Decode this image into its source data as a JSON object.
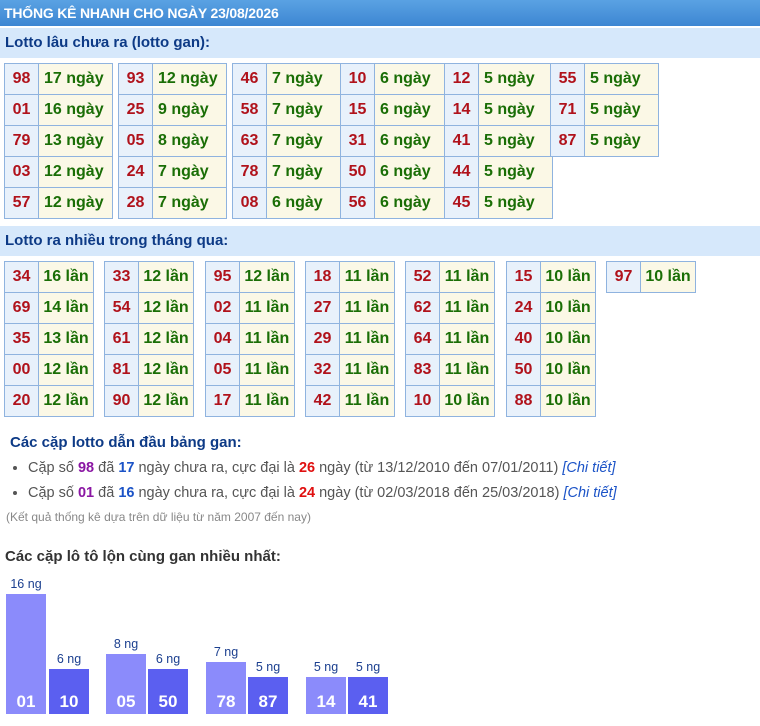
{
  "title": "THỐNG KÊ NHANH CHO NGÀY 23/08/2026",
  "gan": {
    "heading": "Lotto lâu chưa ra (lotto gan):",
    "groups": [
      [
        [
          "98",
          "17 ngày"
        ],
        [
          "01",
          "16 ngày"
        ],
        [
          "79",
          "13 ngày"
        ],
        [
          "03",
          "12 ngày"
        ],
        [
          "57",
          "12 ngày"
        ]
      ],
      [
        [
          "93",
          "12 ngày"
        ],
        [
          "25",
          "9 ngày"
        ],
        [
          "05",
          "8 ngày"
        ],
        [
          "24",
          "7 ngày"
        ],
        [
          "28",
          "7 ngày"
        ]
      ],
      [
        [
          "46",
          "7 ngày"
        ],
        [
          "58",
          "7 ngày"
        ],
        [
          "63",
          "7 ngày"
        ],
        [
          "78",
          "7 ngày"
        ],
        [
          "08",
          "6 ngày"
        ]
      ],
      [
        [
          "10",
          "6 ngày"
        ],
        [
          "15",
          "6 ngày"
        ],
        [
          "31",
          "6 ngày"
        ],
        [
          "50",
          "6 ngày"
        ],
        [
          "56",
          "6 ngày"
        ]
      ],
      [
        [
          "12",
          "5 ngày"
        ],
        [
          "14",
          "5 ngày"
        ],
        [
          "41",
          "5 ngày"
        ],
        [
          "44",
          "5 ngày"
        ],
        [
          "45",
          "5 ngày"
        ]
      ],
      [
        [
          "55",
          "5 ngày"
        ],
        [
          "71",
          "5 ngày"
        ],
        [
          "87",
          "5 ngày"
        ]
      ]
    ]
  },
  "nhieu": {
    "heading": "Lotto ra nhiều trong tháng qua:",
    "groups": [
      [
        [
          "34",
          "16 lần"
        ],
        [
          "69",
          "14 lần"
        ],
        [
          "35",
          "13 lần"
        ],
        [
          "00",
          "12 lần"
        ],
        [
          "20",
          "12 lần"
        ]
      ],
      [
        [
          "33",
          "12 lần"
        ],
        [
          "54",
          "12 lần"
        ],
        [
          "61",
          "12 lần"
        ],
        [
          "81",
          "12 lần"
        ],
        [
          "90",
          "12 lần"
        ]
      ],
      [
        [
          "95",
          "12 lần"
        ],
        [
          "02",
          "11 lần"
        ],
        [
          "04",
          "11 lần"
        ],
        [
          "05",
          "11 lần"
        ],
        [
          "17",
          "11 lần"
        ]
      ],
      [
        [
          "18",
          "11 lần"
        ],
        [
          "27",
          "11 lần"
        ],
        [
          "29",
          "11 lần"
        ],
        [
          "32",
          "11 lần"
        ],
        [
          "42",
          "11 lần"
        ]
      ],
      [
        [
          "52",
          "11 lần"
        ],
        [
          "62",
          "11 lần"
        ],
        [
          "64",
          "11 lần"
        ],
        [
          "83",
          "11 lần"
        ],
        [
          "10",
          "10 lần"
        ]
      ],
      [
        [
          "15",
          "10 lần"
        ],
        [
          "24",
          "10 lần"
        ],
        [
          "40",
          "10 lần"
        ],
        [
          "50",
          "10 lần"
        ],
        [
          "88",
          "10 lần"
        ]
      ],
      [
        [
          "97",
          "10 lần"
        ]
      ]
    ]
  },
  "cap": {
    "heading": "Các cặp lotto dẫn đầu bảng gan:",
    "items": [
      {
        "pre": "Cặp số ",
        "pair": "98",
        "mid1": " đã ",
        "days": "17",
        "mid2": " ngày chưa ra, cực đại là ",
        "max": "26",
        "mid3": " ngày (từ 13/12/2010 đến 07/01/2011) ",
        "link": "[Chi tiết]"
      },
      {
        "pre": "Cặp số ",
        "pair": "01",
        "mid1": " đã ",
        "days": "16",
        "mid2": " ngày chưa ra, cực đại là ",
        "max": "24",
        "mid3": " ngày (từ 02/03/2018 đến 25/03/2018) ",
        "link": "[Chi tiết]"
      }
    ],
    "note": "(Kết quả thống kê dựa trên dữ liệu từ năm 2007 đến nay)"
  },
  "chart_heading": "Các cặp lô tô lộn cùng gan nhiều nhất:",
  "chart_data": {
    "type": "bar",
    "categories": [
      "01",
      "10",
      "05",
      "50",
      "78",
      "87",
      "14",
      "41"
    ],
    "values": [
      16,
      6,
      8,
      6,
      7,
      5,
      5,
      5
    ],
    "value_labels": [
      "16 ng",
      "6 ng",
      "8 ng",
      "6 ng",
      "7 ng",
      "5 ng",
      "5 ng",
      "5 ng"
    ],
    "colors": [
      "#8b8bfb",
      "#5b5ff0"
    ]
  }
}
